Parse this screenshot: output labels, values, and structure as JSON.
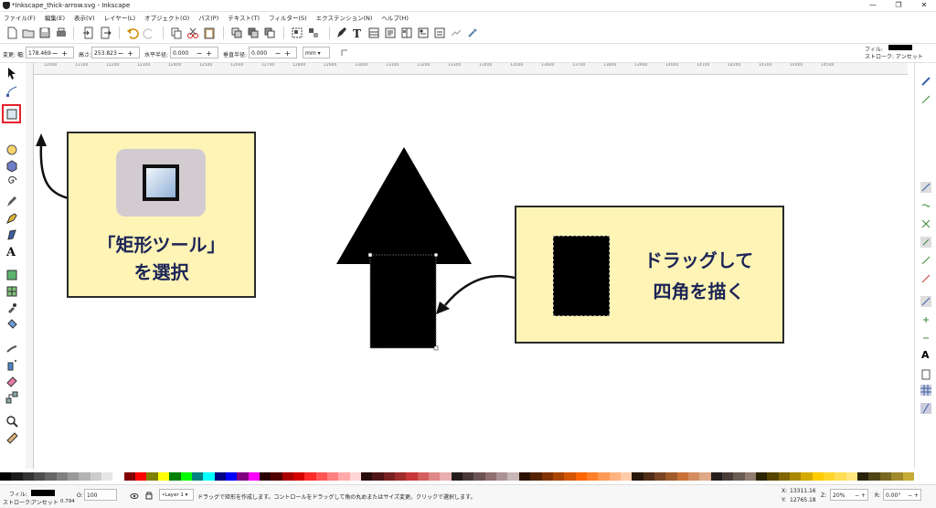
{
  "window": {
    "title": "*Inkscape_thick-arrow.svg - Inkscape",
    "controls": [
      "—",
      "❐",
      "✕"
    ]
  },
  "menu": [
    "ファイル(F)",
    "編集(E)",
    "表示(V)",
    "レイヤー(L)",
    "オブジェクト(O)",
    "パス(P)",
    "テキスト(T)",
    "フィルター(S)",
    "エクステンション(N)",
    "ヘルプ(H)"
  ],
  "controls": {
    "change_label": "変更: 幅:",
    "width": "178.469",
    "height_label": "高さ:",
    "height": "253.823",
    "rx_label": "水平半径:",
    "rx": "0.000",
    "ry_label": "垂直半径:",
    "ry": "0.000",
    "unit": "mm",
    "fill_label": "フィル:",
    "stroke_label": "ストローク: アンセット"
  },
  "ruler_ticks": [
    "12000",
    "12100",
    "12200",
    "12300",
    "12400",
    "12500",
    "12600",
    "12700",
    "12800",
    "12900",
    "13000",
    "13100",
    "13200",
    "13300",
    "13400",
    "13500",
    "13600",
    "13700",
    "13800",
    "13900",
    "14000",
    "14100",
    "14200",
    "14300",
    "14400",
    "14500"
  ],
  "callouts": {
    "left_line1": "「矩形ツール」",
    "left_line2": "を選択",
    "right_line1": "ドラッグして",
    "right_line2": "四角を描く"
  },
  "status": {
    "fill_label": "フィル:",
    "stroke_label": "ストローク:",
    "stroke_value": "アンセット",
    "stroke_width": "0.794",
    "opacity_label": "O:",
    "opacity": "100",
    "layer": "Layer 1",
    "message": "ドラッグで矩形を作成します。コントロールをドラッグして角の丸めまたはサイズ変更。クリックで選択します。",
    "x_label": "X:",
    "x_value": "13311.16",
    "y_label": "Y:",
    "y_value": "12765.18",
    "zoom_label": "Z:",
    "zoom": "20%",
    "rotate_label": "R:",
    "rotate": "0.00°"
  },
  "colors": {
    "callout_bg": "#fdf4b5",
    "callout_text": "#1c2456",
    "highlight": "#e8202a"
  }
}
